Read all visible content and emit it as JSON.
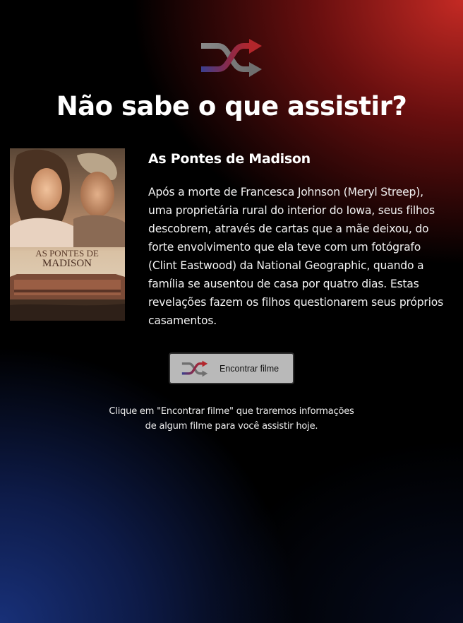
{
  "header": {
    "icon": "shuffle-icon",
    "title": "Não sabe o que assistir?"
  },
  "movie": {
    "poster_icon": "movie-poster",
    "poster_title_top": "AS PONTES DE",
    "poster_title_bottom": "MADISON",
    "title": "As Pontes de Madison",
    "synopsis": "Após a morte de Francesca Johnson (Meryl Streep), uma proprietária rural do interior do Iowa, seus filhos descobrem, através de cartas que a mãe deixou, do forte envolvimento que ela teve com um fotógrafo (Clint Eastwood) da National Geographic, quando a família se ausentou de casa por quatro dias. Estas revelações fazem os filhos questionarem seus próprios casamentos."
  },
  "actions": {
    "find_button_label": "Encontrar filme",
    "find_button_icon": "shuffle-icon"
  },
  "hint": {
    "line1": "Clique em \"Encontrar filme\" que traremos informações",
    "line2": "de algum filme para você assistir hoje."
  },
  "colors": {
    "gradient_top_right": "#c42a24",
    "gradient_bottom_left": "#183078",
    "icon_blue": "#3a3f8f",
    "icon_red": "#b3262b",
    "button_bg": "#b9b9b9"
  }
}
